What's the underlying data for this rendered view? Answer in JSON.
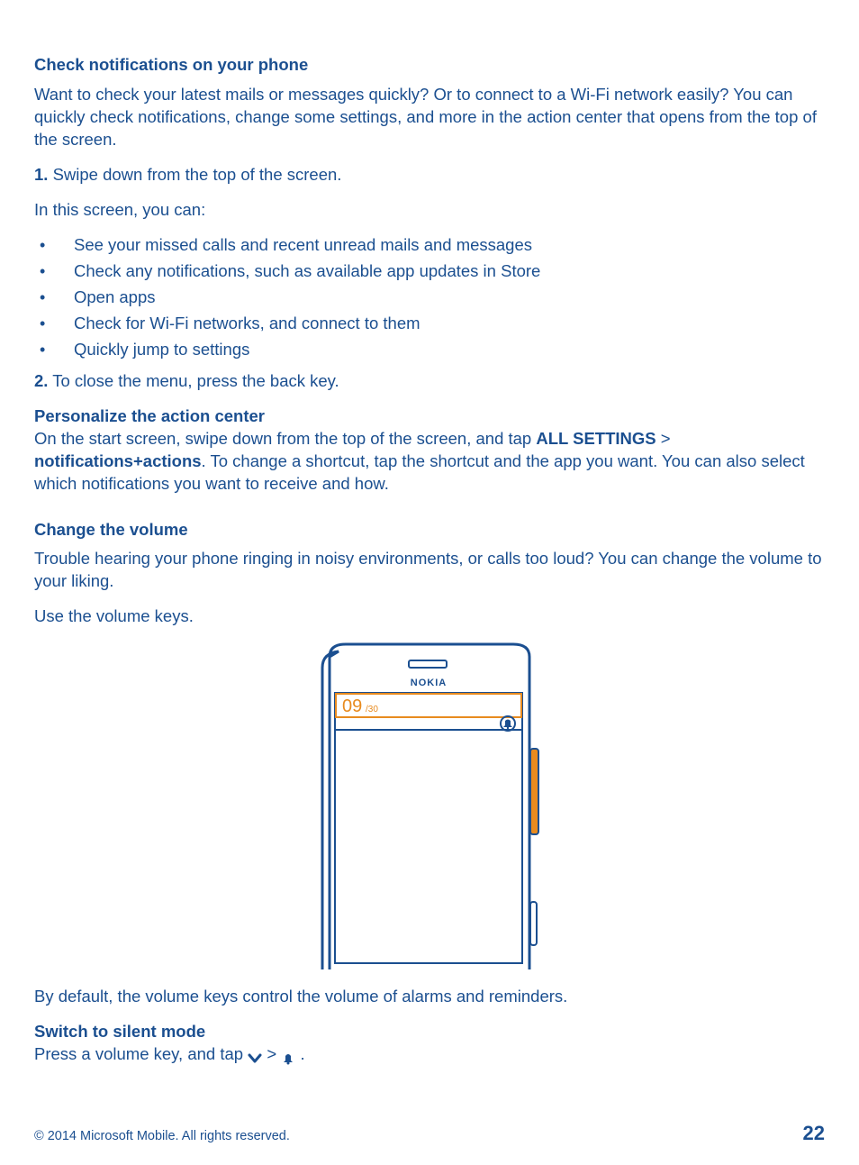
{
  "section1": {
    "heading": "Check notifications on your phone",
    "intro": "Want to check your latest mails or messages quickly? Or to connect to a Wi-Fi network easily? You can quickly check notifications, change some settings, and more in the action center that opens from the top of the screen.",
    "step1_num": "1.",
    "step1_text": " Swipe down from the top of the screen.",
    "canline": "In this screen, you can:",
    "bullets": [
      "See your missed calls and recent unread mails and messages",
      "Check any notifications, such as available app updates in Store",
      "Open apps",
      "Check for Wi-Fi networks, and connect to them",
      "Quickly jump to settings"
    ],
    "step2_num": "2.",
    "step2_text": " To close the menu, press the back key."
  },
  "section2": {
    "heading": "Personalize the action center",
    "text_before": "On the start screen, swipe down from the top of the screen, and tap ",
    "allsettings": "ALL SETTINGS",
    "gt": " > ",
    "notif": "notifications+actions",
    "text_after": ". To change a shortcut, tap the shortcut and the app you want. You can also select which notifications you want to receive and how."
  },
  "section3": {
    "heading": "Change the volume",
    "intro": "Trouble hearing your phone ringing in noisy environments, or calls too loud? You can change the volume to your liking.",
    "use": "Use the volume keys.",
    "phone_brand": "NOKIA",
    "volume_current": "09",
    "volume_max": "/30",
    "bydefault": "By default, the volume keys control the volume of alarms and reminders."
  },
  "section4": {
    "heading": "Switch to silent mode",
    "text_before": "Press a volume key, and tap ",
    "gt": " > ",
    "period": " ."
  },
  "footer": {
    "copyright": "© 2014 Microsoft Mobile. All rights reserved.",
    "page": "22"
  }
}
